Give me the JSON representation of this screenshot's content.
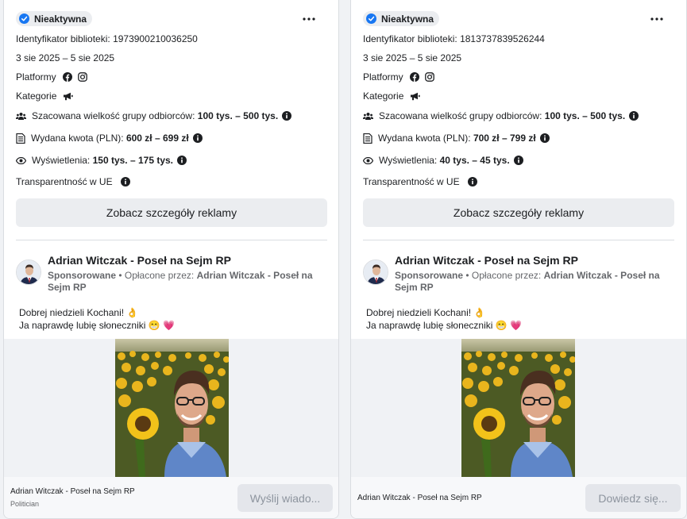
{
  "colors": {
    "accent": "#1877f2",
    "text": "#1c1e21",
    "muted": "#65676b",
    "bg": "#f0f2f5",
    "button": "#ebedf0"
  },
  "cards": [
    {
      "status": "Nieaktywna",
      "library_id": "Identyfikator biblioteki: 1973900210036250",
      "dates": "3 sie 2025 – 5 sie 2025",
      "platforms_label": "Platformy",
      "platforms": [
        "facebook-icon",
        "instagram-icon"
      ],
      "categories_label": "Kategorie",
      "audience_label": "Szacowana wielkość grupy odbiorców:",
      "audience_value": "100 tys. – 500 tys.",
      "spent_label": "Wydana kwota (PLN):",
      "spent_value": "600 zł – 699 zł",
      "views_label": "Wyświetlenia:",
      "views_value": "150 tys. – 175 tys.",
      "eu_label": "Transparentność w UE",
      "details_button": "Zobacz szczegóły reklamy",
      "page_name": "Adrian Witczak - Poseł na Sejm RP",
      "sponsored": "Sponsorowane",
      "paid_by_label": " • Opłacone przez: ",
      "paid_by": "Adrian Witczak - Poseł na Sejm RP",
      "ad_line1": "Dobrej niedzieli Kochani! 👌",
      "ad_line2": "Ja naprawdę lubię słoneczniki 😁 💗",
      "footer_name": "Adrian Witczak - Poseł na Sejm RP",
      "footer_category": "Politician",
      "cta": "Wyślij wiado..."
    },
    {
      "status": "Nieaktywna",
      "library_id": "Identyfikator biblioteki: 1813737839526244",
      "dates": "3 sie 2025 – 5 sie 2025",
      "platforms_label": "Platformy",
      "platforms": [
        "facebook-icon",
        "instagram-icon"
      ],
      "categories_label": "Kategorie",
      "audience_label": "Szacowana wielkość grupy odbiorców:",
      "audience_value": "100 tys. – 500 tys.",
      "spent_label": "Wydana kwota (PLN):",
      "spent_value": "700 zł – 799 zł",
      "views_label": "Wyświetlenia:",
      "views_value": "40 tys. – 45 tys.",
      "eu_label": "Transparentność w UE",
      "details_button": "Zobacz szczegóły reklamy",
      "page_name": "Adrian Witczak - Poseł na Sejm RP",
      "sponsored": "Sponsorowane",
      "paid_by_label": " • Opłacone przez: ",
      "paid_by": "Adrian Witczak - Poseł na Sejm RP",
      "ad_line1": "Dobrej niedzieli Kochani! 👌",
      "ad_line2": "Ja naprawdę lubię słoneczniki 😁 💗",
      "footer_name": "Adrian Witczak - Poseł na Sejm RP",
      "footer_category": "",
      "cta": "Dowiedz się..."
    }
  ]
}
